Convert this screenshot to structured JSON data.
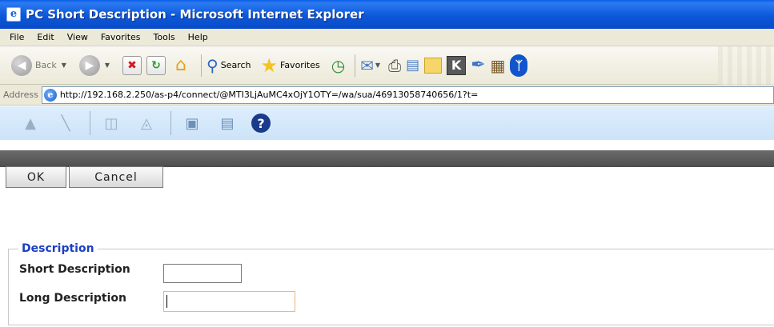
{
  "window": {
    "title": "PC Short Description - Microsoft Internet Explorer"
  },
  "menu": {
    "items": [
      "File",
      "Edit",
      "View",
      "Favorites",
      "Tools",
      "Help"
    ]
  },
  "toolbar": {
    "back_label": "Back",
    "search_label": "Search",
    "favorites_label": "Favorites",
    "icons": [
      "back-icon",
      "forward-icon",
      "stop-icon",
      "refresh-icon",
      "home-icon",
      "search-icon",
      "favorites-star-icon",
      "history-icon",
      "mail-icon",
      "print-icon",
      "edit-icon",
      "note-icon",
      "k-icon",
      "pen-icon",
      "books-icon",
      "bluetooth-icon"
    ]
  },
  "address": {
    "label": "Address",
    "url": "http://192.168.2.250/as-p4/connect/@MTI3LjAuMC4xOjY1OTY=/wa/sua/46913058740656/1?t="
  },
  "app_toolbar": {
    "icons": [
      "app-home-icon",
      "app-tool-icon",
      "add-item-icon",
      "remove-item-icon",
      "window-icon",
      "list-icon",
      "help-icon"
    ],
    "help_glyph": "?"
  },
  "actions": {
    "ok_label": "OK",
    "cancel_label": "Cancel"
  },
  "form": {
    "legend": "Description",
    "short_description_label": "Short Description",
    "short_description_value": "",
    "long_description_label": "Long Description",
    "long_description_value": ""
  },
  "colors": {
    "titlebar": "#0a5fe8",
    "legend": "#1c3fc2",
    "focus_border": "#f2b27a"
  }
}
